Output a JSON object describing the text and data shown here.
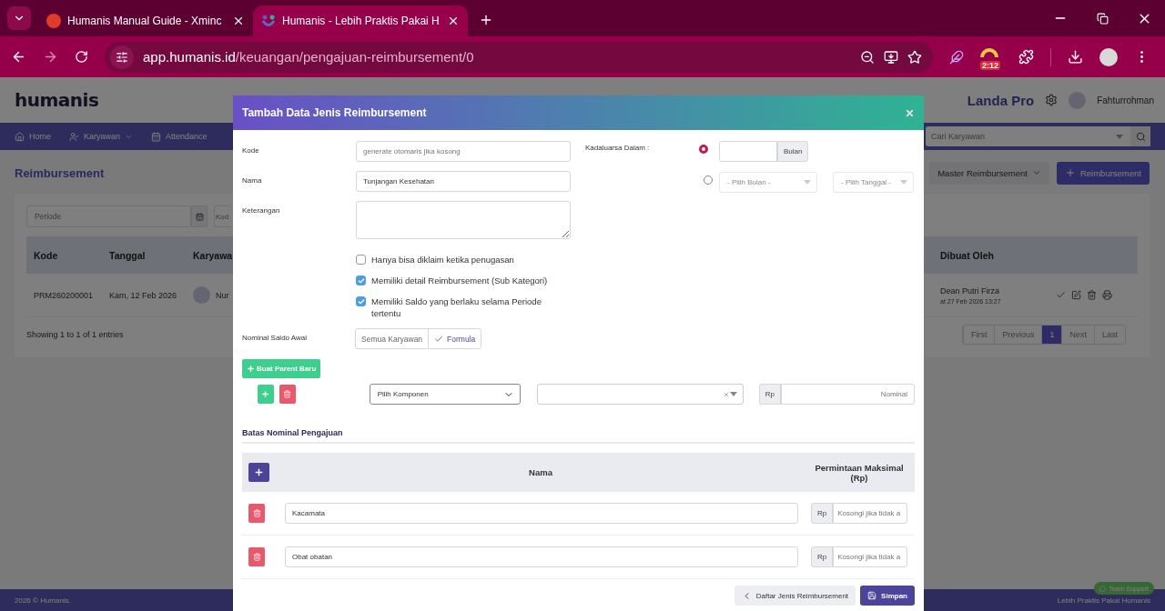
{
  "browser": {
    "tabs": [
      {
        "title": "Humanis Manual Guide - Xminc",
        "selected": false
      },
      {
        "title": "Humanis - Lebih Praktis Pakai H",
        "selected": true
      }
    ],
    "url": {
      "host": "app.humanis.id",
      "path": "/keuangan/pengajuan-reimbursement/0"
    },
    "extension_badge": "2:12"
  },
  "app": {
    "logo": "humanis",
    "company": "Landa Pro",
    "user": "Fahturrohman",
    "nav": [
      {
        "label": "Home",
        "kind": "home",
        "dropdown": false
      },
      {
        "label": "Karyawan",
        "kind": "people",
        "dropdown": true
      },
      {
        "label": "Attendance",
        "kind": "calendar",
        "dropdown": false
      }
    ],
    "search_placeholder": "Cari Karyawan",
    "page_title": "Reimbursement",
    "actions": [
      {
        "label": "Master Reimbursement",
        "kind": "menu"
      },
      {
        "label": "Reimbursement",
        "kind": "add"
      }
    ],
    "filters": [
      {
        "placeholder": "Periode"
      },
      {
        "placeholder": "Kod"
      }
    ],
    "columns": [
      "Kode",
      "Tanggal",
      "Karyawa",
      "Dibuat Oleh"
    ],
    "rows": [
      {
        "kode": "PRM260200001",
        "tanggal": "Kam, 12 Feb 2026",
        "karyawan": "Nur",
        "dibuat_oleh": "Dean Putri Firza",
        "dibuat_pada": "at 27 Feb 2026 13:27"
      }
    ],
    "entries_info": "Showing 1 to 1 of 1 entries",
    "pagination": [
      {
        "label": "First",
        "selected": false
      },
      {
        "label": "Previous",
        "selected": false
      },
      {
        "label": "1",
        "selected": true
      },
      {
        "label": "Next",
        "selected": false
      },
      {
        "label": "Last",
        "selected": false
      }
    ],
    "footer": {
      "copyright": "2026 © Humanis.",
      "tagline": "Lebih Praktis Pakai Humanis",
      "support": "Team Support"
    }
  },
  "modal": {
    "title": "Tambah Data Jenis Reimbursement",
    "fields": [
      {
        "label": "Kode",
        "kind": "input",
        "placeholder": "generate otomaris jika kosong"
      },
      {
        "label": "Nama",
        "kind": "input",
        "value": "Tunjangan Kesehatan"
      },
      {
        "label": "Keterangan",
        "kind": "textarea"
      }
    ],
    "options": [
      {
        "label": "Hanya bisa diklaim ketika penugasan",
        "checked": false
      },
      {
        "label": "Memiliki detail Reimbursement (Sub Kategori)",
        "checked": true
      },
      {
        "label": "Memiliki Saldo yang berlaku selama Periode tertentu",
        "checked": true
      }
    ],
    "saldo": {
      "label": "Nominal Saldo Awal",
      "choices": [
        {
          "label": "Semua Karyawan",
          "selected": false
        },
        {
          "label": "Formula",
          "selected": true
        }
      ]
    },
    "expiry": {
      "label": "Kadaluarsa Dalam :",
      "options": [
        {
          "kind": "duration",
          "selected": true,
          "unit": "Bulan"
        },
        {
          "kind": "date",
          "selected": false,
          "selects": [
            "- Pilih Bulan -",
            "- Pilih Tanggal -"
          ]
        }
      ]
    },
    "parent_button": "Buat Parent Baru",
    "component_row": {
      "select": "Pilih Komponen",
      "currency": "Rp",
      "placeholder": "Nominal"
    },
    "limits": {
      "title": "Batas Nominal Pengajuan",
      "columns": [
        "Nama",
        "Permintaan Maksimal (Rp)"
      ],
      "rows": [
        {
          "name": "Kacamata",
          "currency": "Rp",
          "placeholder": "Kosongi jika tidak a"
        },
        {
          "name": "Obat obatan",
          "currency": "Rp",
          "placeholder": "Kosongi jika tidak a"
        }
      ]
    },
    "buttons": [
      {
        "label": "Daftar Jenis Reimbursement",
        "kind": "back"
      },
      {
        "label": "Simpan",
        "kind": "save"
      }
    ]
  }
}
